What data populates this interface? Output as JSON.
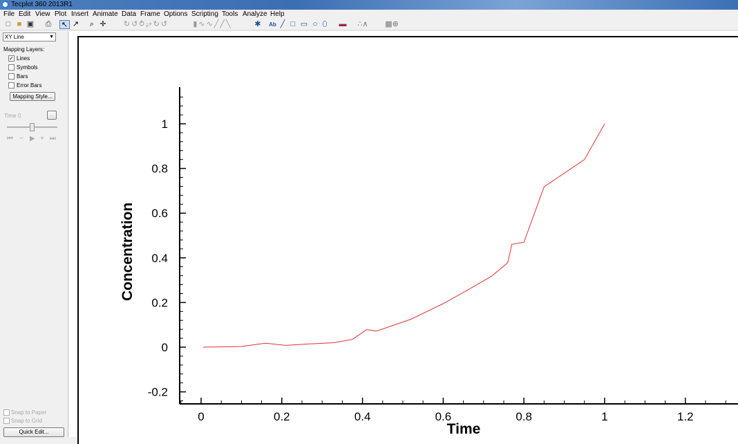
{
  "window": {
    "title": "Tecplot 360 2013R1"
  },
  "menu": [
    "File",
    "Edit",
    "View",
    "Plot",
    "Insert",
    "Animate",
    "Data",
    "Frame",
    "Options",
    "Scripting",
    "Tools",
    "Analyze",
    "Help"
  ],
  "sidebar": {
    "plot_type": "XY Line",
    "mapping_layers_label": "Mapping Layers:",
    "layers": [
      {
        "label": "Lines",
        "checked": true
      },
      {
        "label": "Symbols",
        "checked": false
      },
      {
        "label": "Bars",
        "checked": false
      },
      {
        "label": "Error Bars",
        "checked": false
      }
    ],
    "mapping_style_button": "Mapping Style...",
    "time_label": "Time",
    "time_value": "0",
    "time_button": "...",
    "snap_to_paper": "Snap to Paper",
    "snap_to_grid": "Snap to Grid",
    "quick_edit_button": "Quick Edit..."
  },
  "chart_data": {
    "type": "line",
    "xlabel": "Time",
    "ylabel": "Concentration",
    "xlim": [
      -0.05,
      1.32
    ],
    "ylim": [
      -0.25,
      1.15
    ],
    "xticks": [
      "0",
      "0.2",
      "0.4",
      "0.6",
      "0.8",
      "1",
      "1.2"
    ],
    "xtick_values": [
      0,
      0.2,
      0.4,
      0.6,
      0.8,
      1.0,
      1.2
    ],
    "yticks": [
      "-0.2",
      "0",
      "0.2",
      "0.4",
      "0.6",
      "0.8",
      "1"
    ],
    "ytick_values": [
      -0.2,
      0,
      0.2,
      0.4,
      0.6,
      0.8,
      1.0
    ],
    "line_color": "#e03030",
    "series": [
      {
        "x": [
          0.005,
          0.1,
          0.16,
          0.21,
          0.27,
          0.33,
          0.375,
          0.41,
          0.435,
          0.52,
          0.6,
          0.66,
          0.72,
          0.76,
          0.77,
          0.8,
          0.85,
          0.95,
          1.0
        ],
        "y": [
          0.0,
          0.003,
          0.018,
          0.008,
          0.015,
          0.02,
          0.035,
          0.078,
          0.072,
          0.125,
          0.195,
          0.255,
          0.318,
          0.378,
          0.46,
          0.47,
          0.718,
          0.84,
          1.0
        ]
      }
    ]
  }
}
